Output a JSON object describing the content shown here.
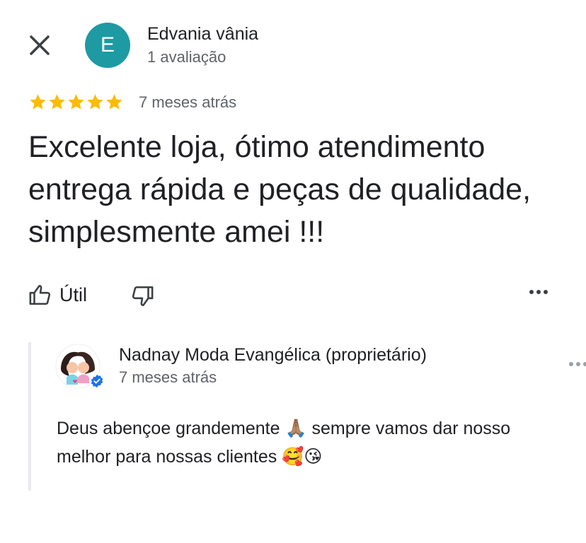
{
  "reviewer": {
    "avatar_letter": "E",
    "avatar_color": "#1e9aa3",
    "name": "Edvania vânia",
    "review_count": "1 avaliação"
  },
  "review": {
    "rating": 5,
    "star_color": "#fbbc04",
    "date": "7 meses atrás",
    "text": "Excelente loja, ótimo atendimento entrega rápida e peças de qualidade, simplesmente amei !!!"
  },
  "actions": {
    "useful_label": "Útil",
    "icons": [
      "close-icon",
      "thumbs-up-icon",
      "thumbs-down-icon",
      "more-horizontal-icon"
    ]
  },
  "owner_reply": {
    "name": "Nadnay Moda Evangélica (proprietário)",
    "date": "7 meses atrás",
    "text": "Deus abençoe grandemente 🙏🏽 sempre vamos dar nosso melhor para nossas clientes 🥰😘",
    "verified_badge_color": "#1a73e8"
  }
}
